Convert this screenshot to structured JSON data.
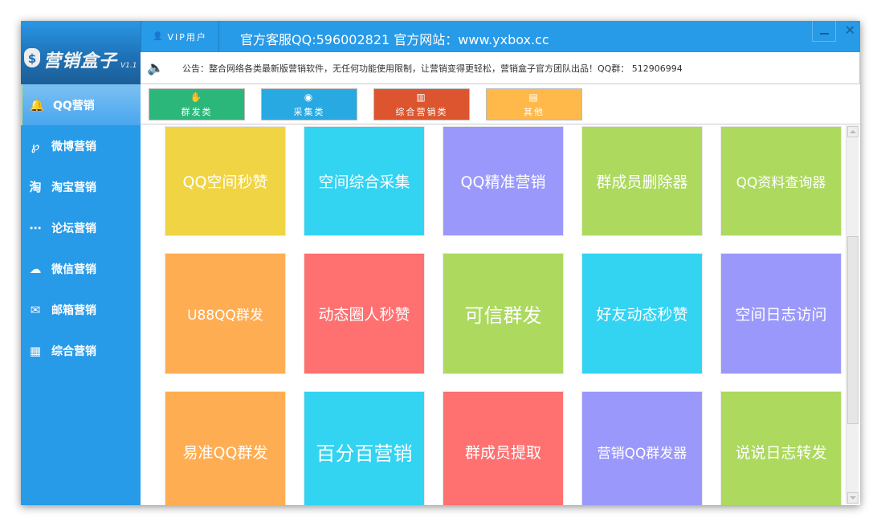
{
  "app": {
    "logo_text": "营销盒子",
    "version": "V1.1",
    "user_label": "VIP用户",
    "title": "官方客服QQ:596002821 官方网站：www.yxbox.cc"
  },
  "notice": {
    "text": "公告：整合网络各类最新版营销软件，无任何功能使用限制，让营销变得更轻松，营销盒子官方团队出品！QQ群： 512906994"
  },
  "sidebar": {
    "items": [
      {
        "label": "QQ营销",
        "icon": "qq-icon"
      },
      {
        "label": "微博营销",
        "icon": "weibo-icon"
      },
      {
        "label": "淘宝营销",
        "icon": "taobao-icon"
      },
      {
        "label": "论坛营销",
        "icon": "forum-icon"
      },
      {
        "label": "微信营销",
        "icon": "wechat-icon"
      },
      {
        "label": "邮箱营销",
        "icon": "mail-icon"
      },
      {
        "label": "综合营销",
        "icon": "calendar-icon"
      }
    ]
  },
  "tabs": [
    {
      "label": "群发类",
      "color": "#2bb77a"
    },
    {
      "label": "采集类",
      "color": "#28a9e2"
    },
    {
      "label": "综合营销类",
      "color": "#dc552e"
    },
    {
      "label": "其他",
      "color": "#ffb94a"
    }
  ],
  "tiles": [
    {
      "label": "QQ空间秒赞",
      "color": "#f0d444"
    },
    {
      "label": "空间综合采集",
      "color": "#33d3f2"
    },
    {
      "label": "QQ精准营销",
      "color": "#9a98fa"
    },
    {
      "label": "群成员删除器",
      "color": "#acd95e"
    },
    {
      "label": "QQ资料查询器",
      "color": "#acd95e"
    },
    {
      "label": "U88QQ群发",
      "color": "#ffad52"
    },
    {
      "label": "动态圈人秒赞",
      "color": "#ff7070"
    },
    {
      "label": "可信群发",
      "color": "#acd95e"
    },
    {
      "label": "好友动态秒赞",
      "color": "#33d3f2"
    },
    {
      "label": "空间日志访问",
      "color": "#9a98fa"
    },
    {
      "label": "易准QQ群发",
      "color": "#ffad52"
    },
    {
      "label": "百分百营销",
      "color": "#33d3f2"
    },
    {
      "label": "群成员提取",
      "color": "#ff7070"
    },
    {
      "label": "营销QQ群发器",
      "color": "#9a98fa"
    },
    {
      "label": "说说日志转发",
      "color": "#acd95e"
    }
  ]
}
